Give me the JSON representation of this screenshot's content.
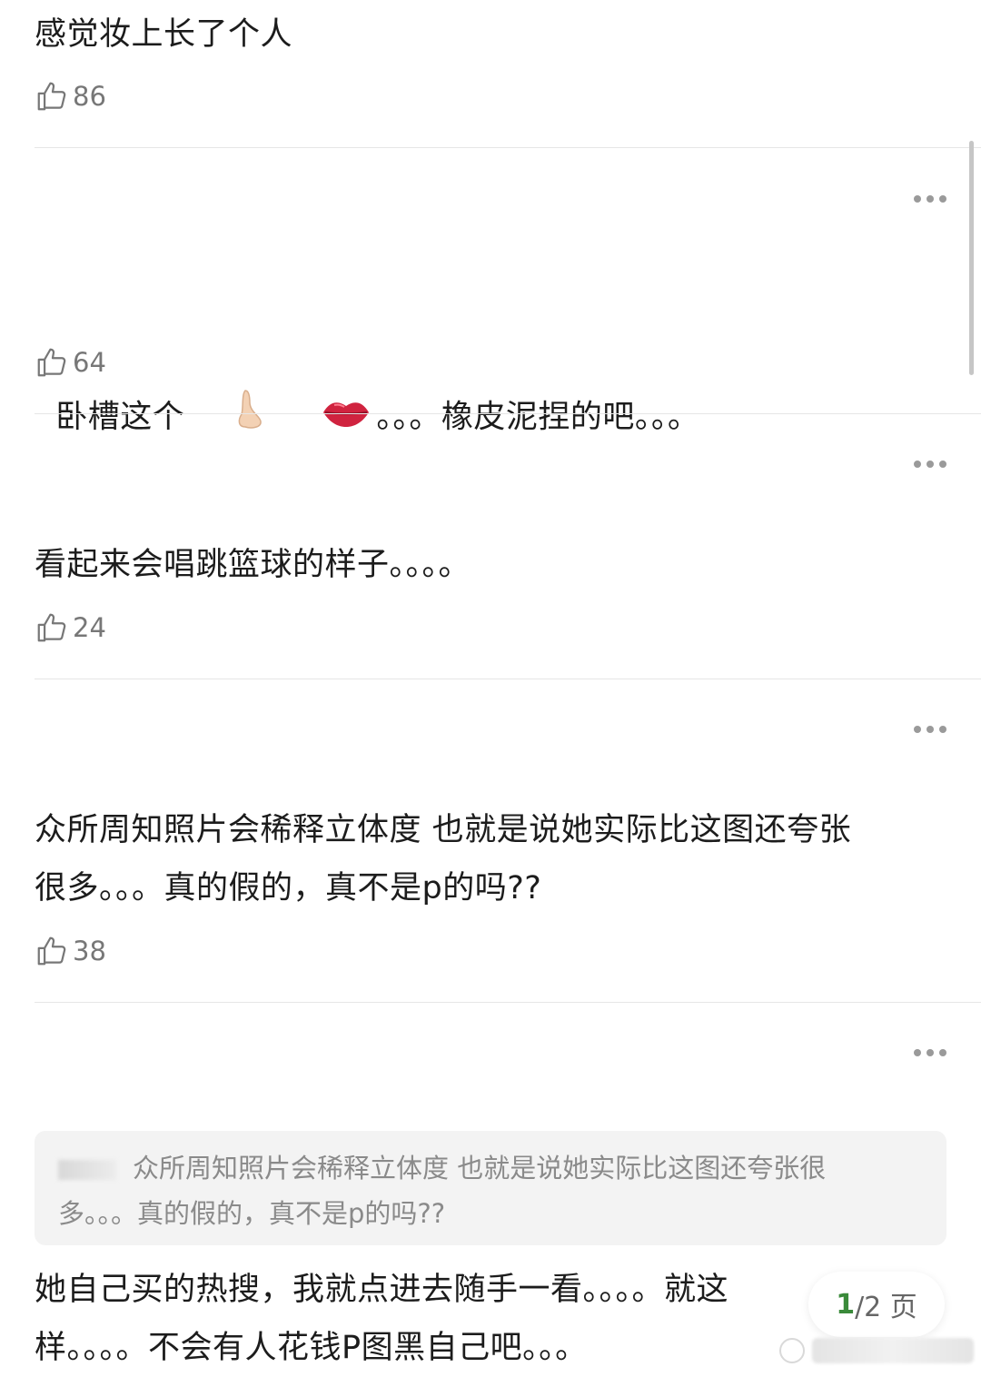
{
  "comments": [
    {
      "text": "感觉妆上长了个人",
      "likes": "86"
    },
    {
      "text_a": "卧槽这个",
      "text_b": "。。。橡皮泥捏的吧。。。",
      "likes": "64",
      "emoji_nose": "nose-emoji",
      "emoji_lips": "lips-emoji"
    },
    {
      "text": "看起来会唱跳篮球的样子。。。。",
      "likes": "24"
    },
    {
      "line1": "众所周知照片会稀释立体度 也就是说她实际比这图还夸张",
      "line2": "很多。。。真的假的，真不是p的吗??",
      "likes": "38"
    },
    {
      "quote_line1": "众所周知照片会稀释立体度 也就是说她实际比这图还夸张很",
      "quote_line2": "多。。。真的假的，真不是p的吗??",
      "line1": "她自己买的热搜，我就点进去随手一看。。。。就这",
      "line2": "样。。。。不会有人花钱P图黑自己吧。。。"
    }
  ],
  "pager": {
    "current": "1",
    "rest": "/2 页"
  },
  "icons": {
    "like": "thumbs-up-icon",
    "more": "more-dots-icon"
  },
  "colors": {
    "pager_current": "#3a8a3a",
    "divider": "#e6e6e6",
    "muted": "#8a8a8a"
  }
}
